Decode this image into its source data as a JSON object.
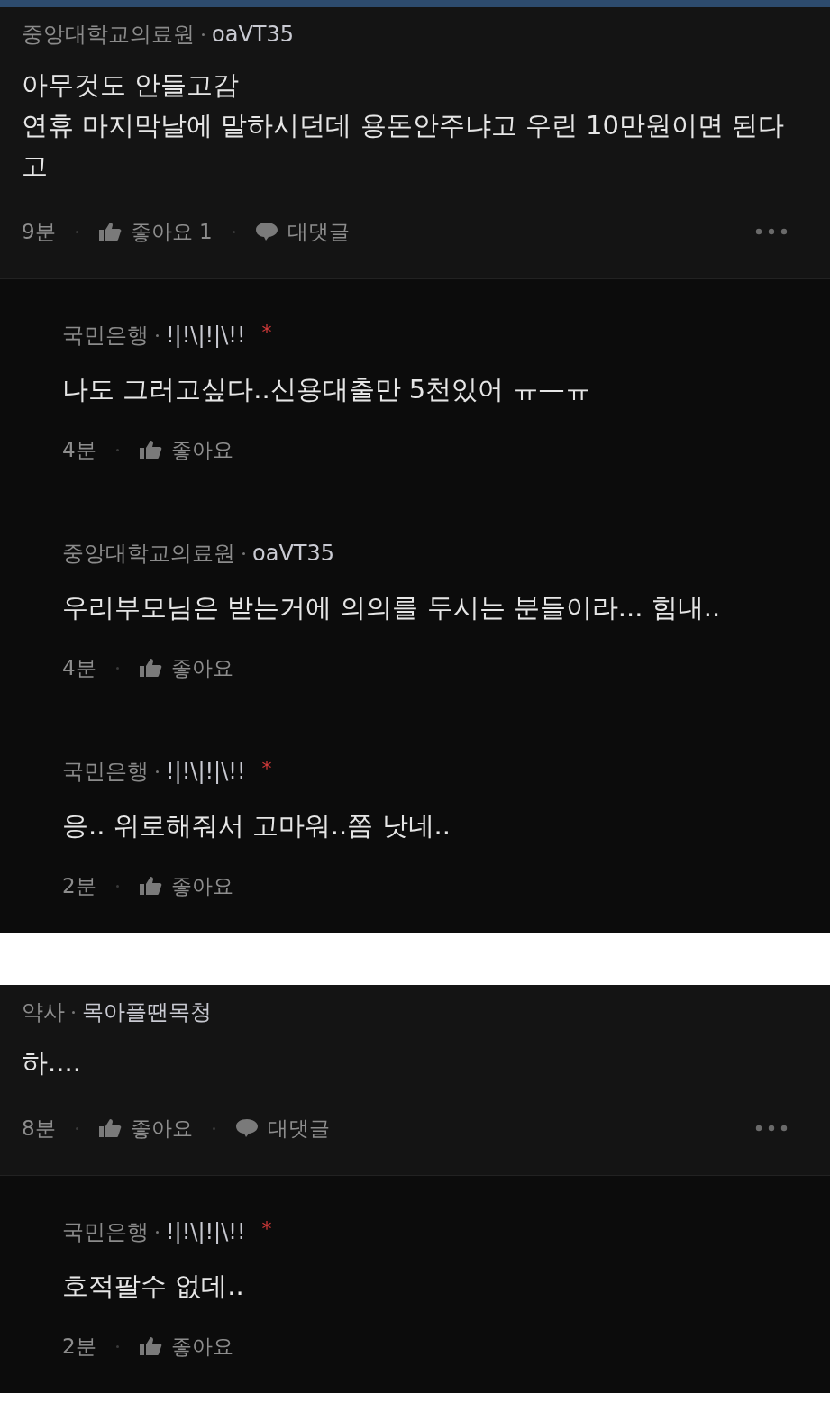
{
  "threads": [
    {
      "comment": {
        "kind": "comment",
        "org": "중앙대학교의료원",
        "nickname": "oaVT35",
        "body": "아무것도 안들고감\n연휴 마지막날에 말하시던데 용돈안주냐고 우린 10만원이면 된다고",
        "time": "9분",
        "like_label": "좋아요 1",
        "reply_label": "대댓글"
      },
      "replies": [
        {
          "kind": "reply",
          "org": "국민은행",
          "nickname": "!|!\\|!|\\!!",
          "badge": "*",
          "body": "나도 그러고싶다..신용대출만 5천있어 ㅠ—ㅠ",
          "time": "4분",
          "like_label": "좋아요"
        },
        {
          "kind": "reply",
          "org": "중앙대학교의료원",
          "nickname": "oaVT35",
          "body": "우리부모님은 받는거에 의의를 두시는 분들이라... 힘내..",
          "time": "4분",
          "like_label": "좋아요"
        },
        {
          "kind": "reply",
          "org": "국민은행",
          "nickname": "!|!\\|!|\\!!",
          "badge": "*",
          "body": "응.. 위로해줘서 고마워..쫌 낫네..",
          "time": "2분",
          "like_label": "좋아요"
        }
      ]
    },
    {
      "comment": {
        "kind": "comment",
        "org": "약사",
        "nickname": "목아플땐목청",
        "body": "하....",
        "time": "8분",
        "like_label": "좋아요",
        "reply_label": "대댓글"
      },
      "replies": [
        {
          "kind": "reply",
          "org": "국민은행",
          "nickname": "!|!\\|!|\\!!",
          "badge": "*",
          "body": "호적팔수 없데..",
          "time": "2분",
          "like_label": "좋아요"
        }
      ]
    }
  ]
}
